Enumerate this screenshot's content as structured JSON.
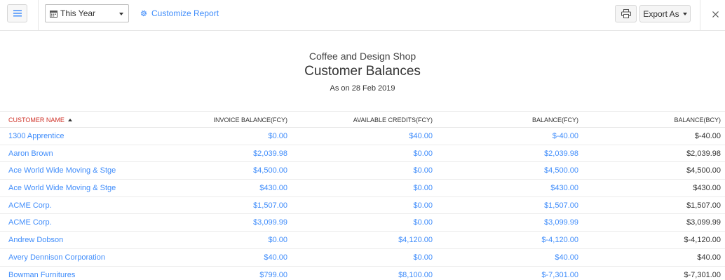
{
  "toolbar": {
    "period_select": {
      "value": "This Year"
    },
    "customize_label": "Customize Report",
    "export_label": "Export As"
  },
  "report": {
    "organization": "Coffee and Design Shop",
    "title": "Customer Balances",
    "as_on": "As on 28 Feb 2019"
  },
  "table": {
    "headers": {
      "customer_name": "CUSTOMER NAME",
      "invoice_balance": "INVOICE BALANCE(FCY)",
      "available_credits": "AVAILABLE CREDITS(FCY)",
      "balance_fcy": "BALANCE(FCY)",
      "balance_bcy": "BALANCE(BCY)"
    },
    "sort": {
      "column": "customer_name",
      "direction": "ascending"
    },
    "rows": [
      {
        "name": "1300 Apprentice",
        "invoice": "$0.00",
        "credits": "$40.00",
        "balance_fcy": "$-40.00",
        "balance_bcy": "$-40.00"
      },
      {
        "name": "Aaron Brown",
        "invoice": "$2,039.98",
        "credits": "$0.00",
        "balance_fcy": "$2,039.98",
        "balance_bcy": "$2,039.98"
      },
      {
        "name": "Ace World Wide Moving & Stge",
        "invoice": "$4,500.00",
        "credits": "$0.00",
        "balance_fcy": "$4,500.00",
        "balance_bcy": "$4,500.00"
      },
      {
        "name": "Ace World Wide Moving & Stge",
        "invoice": "$430.00",
        "credits": "$0.00",
        "balance_fcy": "$430.00",
        "balance_bcy": "$430.00"
      },
      {
        "name": "ACME Corp.",
        "invoice": "$1,507.00",
        "credits": "$0.00",
        "balance_fcy": "$1,507.00",
        "balance_bcy": "$1,507.00"
      },
      {
        "name": "ACME Corp.",
        "invoice": "$3,099.99",
        "credits": "$0.00",
        "balance_fcy": "$3,099.99",
        "balance_bcy": "$3,099.99"
      },
      {
        "name": "Andrew Dobson",
        "invoice": "$0.00",
        "credits": "$4,120.00",
        "balance_fcy": "$-4,120.00",
        "balance_bcy": "$-4,120.00"
      },
      {
        "name": "Avery Dennison Corporation",
        "invoice": "$40.00",
        "credits": "$0.00",
        "balance_fcy": "$40.00",
        "balance_bcy": "$40.00"
      },
      {
        "name": "Bowman Furnitures",
        "invoice": "$799.00",
        "credits": "$8,100.00",
        "balance_fcy": "$-7,301.00",
        "balance_bcy": "$-7,301.00"
      }
    ]
  },
  "icons": {
    "menu": "hamburger-menu-icon",
    "calendar": "calendar-icon",
    "gear": "gear-icon",
    "print": "printer-icon",
    "close": "close-icon"
  },
  "colors": {
    "link": "#408dfb",
    "sorted_header": "#d0352b",
    "text": "#333333",
    "border": "#e6e6e6"
  }
}
